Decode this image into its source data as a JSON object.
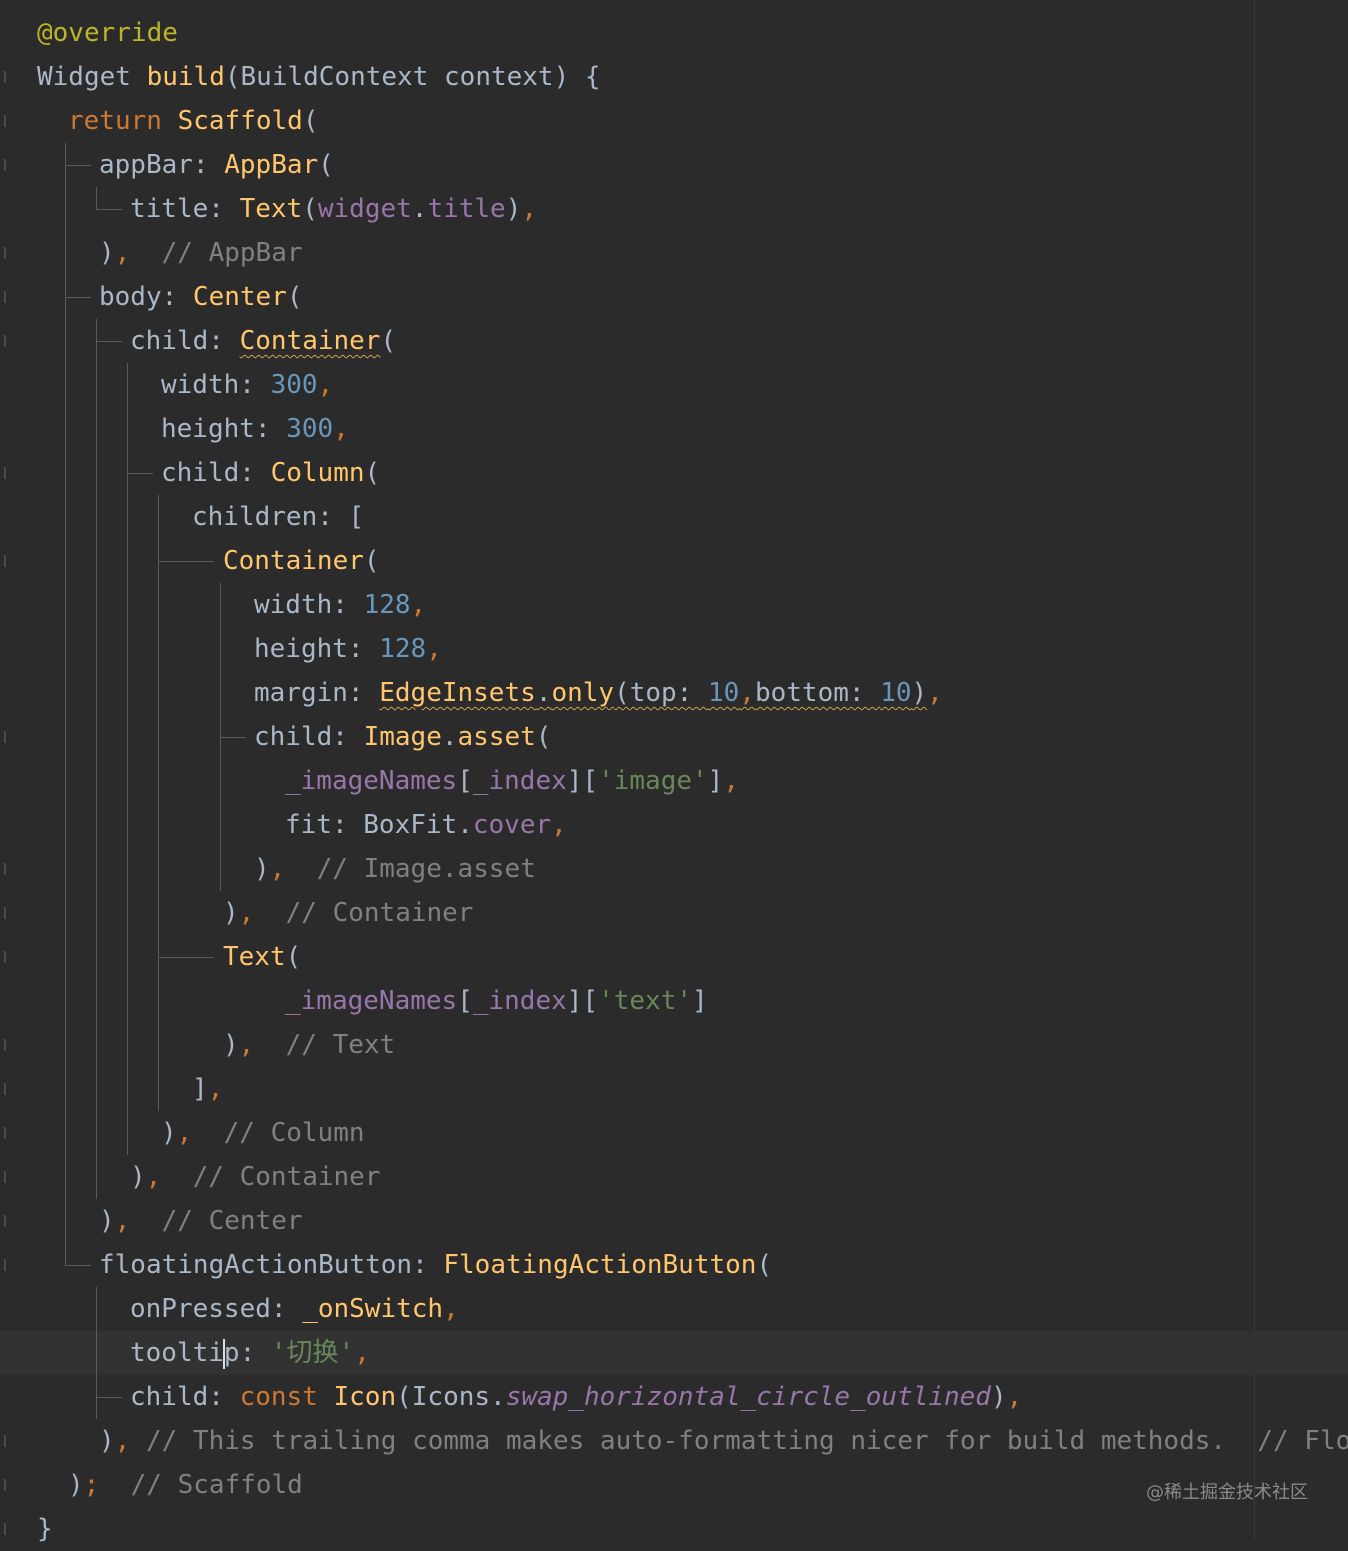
{
  "editor": {
    "language": "dart",
    "theme": "darcula",
    "colors": {
      "background": "#2b2b2b",
      "keyword": "#cc7832",
      "function": "#ffc66d",
      "number": "#6897bb",
      "string": "#6a8759",
      "comment": "#808080",
      "field": "#9876aa",
      "text": "#a9b7c6"
    }
  },
  "code": {
    "l1": {
      "ann": "@",
      "name": "override"
    },
    "l2": {
      "type": "Widget ",
      "fn": "build",
      "rest": "(BuildContext context) {"
    },
    "l3": {
      "kw": "return ",
      "fn": "Scaffold",
      "rest": "("
    },
    "l4": {
      "prop": "appBar: ",
      "fn": "AppBar",
      "rest": "("
    },
    "l5": {
      "prop": "title: ",
      "fn": "Text",
      "open": "(",
      "fld1": "widget",
      "dot": ".",
      "fld2": "title",
      "close": ")",
      "comma": ","
    },
    "l6": {
      "close": ")",
      "comma": ",",
      "comment": "  // AppBar"
    },
    "l7": {
      "prop": "body: ",
      "fn": "Center",
      "rest": "("
    },
    "l8": {
      "prop": "child: ",
      "fn": "Container",
      "rest": "("
    },
    "l9": {
      "prop": "width: ",
      "num": "300",
      "comma": ","
    },
    "l10": {
      "prop": "height: ",
      "num": "300",
      "comma": ","
    },
    "l11": {
      "prop": "child: ",
      "fn": "Column",
      "rest": "("
    },
    "l12": {
      "text": "children: ["
    },
    "l13": {
      "fn": "Container",
      "rest": "("
    },
    "l14": {
      "prop": "width: ",
      "num": "128",
      "comma": ","
    },
    "l15": {
      "prop": "height: ",
      "num": "128",
      "comma": ","
    },
    "l16": {
      "prop": "margin: ",
      "fn1": "EdgeInsets",
      "dot": ".",
      "fn2": "only",
      "open": "(top: ",
      "num1": "10",
      "c1": ",",
      "mid": "bottom: ",
      "num2": "10",
      "close": ")",
      "comma": ","
    },
    "l17": {
      "prop": "child: ",
      "fn1": "Image",
      "dot": ".",
      "fn2": "asset",
      "rest": "("
    },
    "l18": {
      "fld1": "_imageNames",
      "b1": "[",
      "fld2": "_index",
      "b2": "][",
      "str": "'image'",
      "b3": "]",
      "comma": ","
    },
    "l19": {
      "prop": "fit: ",
      "cls": "BoxFit",
      "dot": ".",
      "fld": "cover",
      "comma": ","
    },
    "l20": {
      "close": ")",
      "comma": ",",
      "comment": "  // Image.asset"
    },
    "l21": {
      "close": ")",
      "comma": ",",
      "comment": "  // Container"
    },
    "l22": {
      "fn": "Text",
      "rest": "("
    },
    "l23": {
      "fld1": "_imageNames",
      "b1": "[",
      "fld2": "_index",
      "b2": "][",
      "str": "'text'",
      "b3": "]"
    },
    "l24": {
      "close": ")",
      "comma": ",",
      "comment": "  // Text"
    },
    "l25": {
      "close": "]",
      "comma": ","
    },
    "l26": {
      "close": ")",
      "comma": ",",
      "comment": "  // Column"
    },
    "l27": {
      "close": ")",
      "comma": ",",
      "comment": "  // Container"
    },
    "l28": {
      "close": ")",
      "comma": ",",
      "comment": "  // Center"
    },
    "l29": {
      "prop": "floatingActionButton: ",
      "fn": "FloatingActionButton",
      "rest": "("
    },
    "l30": {
      "prop": "onPressed: ",
      "fn": "_onSwitch",
      "comma": ","
    },
    "l31": {
      "prop_a": "toolti",
      "prop_b": "p: ",
      "str": "'切换'",
      "comma": ","
    },
    "l32": {
      "prop": "child: ",
      "kw": "const ",
      "fn": "Icon",
      "open": "(Icons.",
      "fld": "swap_horizontal_circle_outlined",
      "close": ")",
      "comma": ","
    },
    "l33": {
      "close": ")",
      "comma": ",",
      "comment": " // This trailing comma makes auto-formatting nicer for build methods.  // Flo"
    },
    "l34": {
      "close": ")",
      "semi": ";",
      "comment": "  // Scaffold"
    },
    "l35": {
      "text": "}"
    }
  },
  "watermark": "@稀土掘金技术社区"
}
